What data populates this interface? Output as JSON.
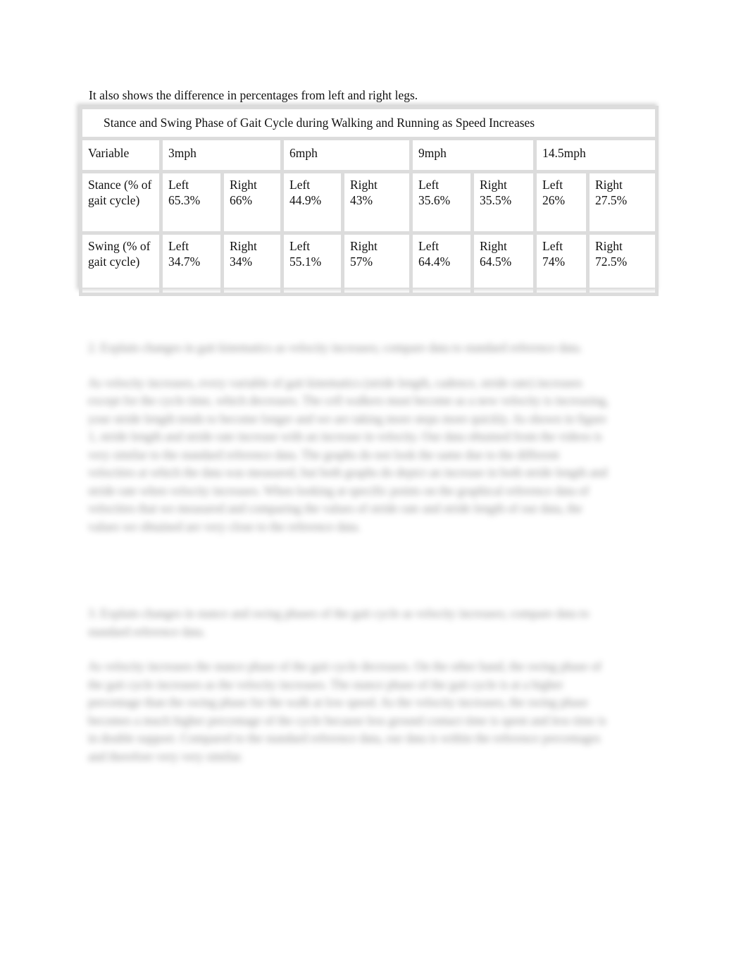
{
  "intro_text": "It also shows the difference in percentages from left and right legs.",
  "table": {
    "caption": "Stance and Swing Phase of Gait Cycle during Walking and Running as Speed Increases",
    "variable_header": "Variable",
    "speeds": [
      "3mph",
      "6mph",
      "9mph",
      "14.5mph"
    ],
    "rows": [
      {
        "label": "Stance (% of gait cycle)",
        "cells": [
          {
            "side": "Left",
            "value": "65.3%"
          },
          {
            "side": "Right",
            "value": "66%"
          },
          {
            "side": "Left",
            "value": "44.9%"
          },
          {
            "side": "Right",
            "value": "43%"
          },
          {
            "side": "Left",
            "value": "35.6%"
          },
          {
            "side": "Right",
            "value": "35.5%"
          },
          {
            "side": "Left",
            "value": "26%"
          },
          {
            "side": "Right",
            "value": "27.5%"
          }
        ]
      },
      {
        "label": "Swing (% of gait cycle)",
        "cells": [
          {
            "side": "Left",
            "value": "34.7%"
          },
          {
            "side": "Right",
            "value": "34%"
          },
          {
            "side": "Left",
            "value": "55.1%"
          },
          {
            "side": "Right",
            "value": "57%"
          },
          {
            "side": "Left",
            "value": "64.4%"
          },
          {
            "side": "Right",
            "value": "64.5%"
          },
          {
            "side": "Left",
            "value": "74%"
          },
          {
            "side": "Right",
            "value": "72.5%"
          }
        ]
      }
    ]
  },
  "blurred_section_1": {
    "question": "2. Explain changes in gait kinematics as velocity increases; compare data to standard reference data.",
    "answer": "As velocity increases, every variable of gait kinematics (stride length, cadence, stride rate) increases except for the cycle time, which decreases. The cell walkers must become as a new velocity is increasing, your stride length tends to become longer and we are taking more steps more quickly. As shown in figure 1, stride length and stride rate increase with an increase in velocity. Our data obtained from the videos is very similar to the standard reference data. The graphs do not look the same due to the different velocities at which the data was measured, but both graphs do depict an increase in both stride length and stride rate when velocity increases. When looking at specific points on the graphical reference data of velocities that we measured and comparing the values of stride rate and stride length of our data, the values we obtained are very close to the reference data."
  },
  "blurred_section_2": {
    "question": "3. Explain changes in stance and swing phases of the gait cycle as velocity increases; compare data to standard reference data.",
    "answer": "As velocity increases the stance phase of the gait cycle decreases. On the other hand, the swing phase of the gait cycle increases as the velocity increases. The stance phase of the gait cycle is at a higher percentage than the swing phase for the walk at low speed. As the velocity increases, the swing phase becomes a much higher percentage of the cycle because less ground contact time is spent and less time is in double support. Compared to the standard reference data, our data is within the reference percentages and therefore very very similar."
  }
}
